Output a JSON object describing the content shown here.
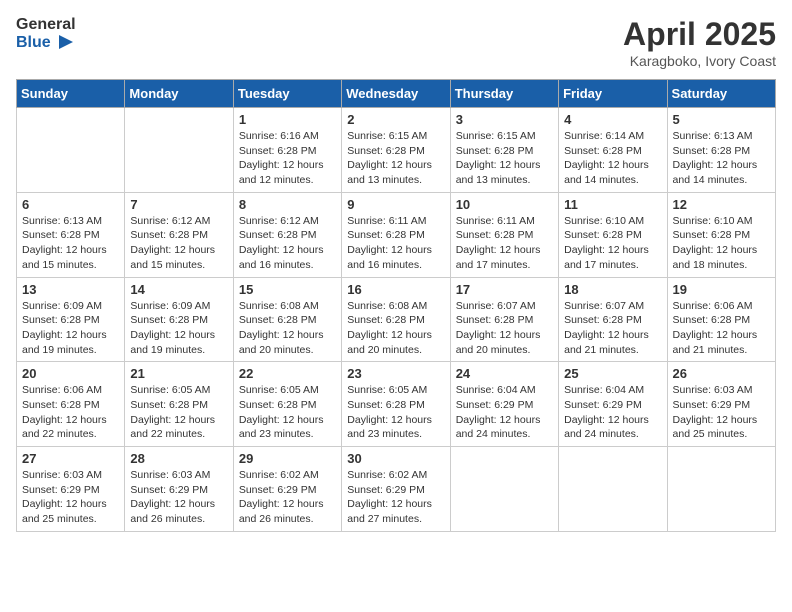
{
  "logo": {
    "text_general": "General",
    "text_blue": "Blue"
  },
  "title": "April 2025",
  "subtitle": "Karagboko, Ivory Coast",
  "weekdays": [
    "Sunday",
    "Monday",
    "Tuesday",
    "Wednesday",
    "Thursday",
    "Friday",
    "Saturday"
  ],
  "weeks": [
    [
      {
        "day": "",
        "info": ""
      },
      {
        "day": "",
        "info": ""
      },
      {
        "day": "1",
        "info": "Sunrise: 6:16 AM\nSunset: 6:28 PM\nDaylight: 12 hours and 12 minutes."
      },
      {
        "day": "2",
        "info": "Sunrise: 6:15 AM\nSunset: 6:28 PM\nDaylight: 12 hours and 13 minutes."
      },
      {
        "day": "3",
        "info": "Sunrise: 6:15 AM\nSunset: 6:28 PM\nDaylight: 12 hours and 13 minutes."
      },
      {
        "day": "4",
        "info": "Sunrise: 6:14 AM\nSunset: 6:28 PM\nDaylight: 12 hours and 14 minutes."
      },
      {
        "day": "5",
        "info": "Sunrise: 6:13 AM\nSunset: 6:28 PM\nDaylight: 12 hours and 14 minutes."
      }
    ],
    [
      {
        "day": "6",
        "info": "Sunrise: 6:13 AM\nSunset: 6:28 PM\nDaylight: 12 hours and 15 minutes."
      },
      {
        "day": "7",
        "info": "Sunrise: 6:12 AM\nSunset: 6:28 PM\nDaylight: 12 hours and 15 minutes."
      },
      {
        "day": "8",
        "info": "Sunrise: 6:12 AM\nSunset: 6:28 PM\nDaylight: 12 hours and 16 minutes."
      },
      {
        "day": "9",
        "info": "Sunrise: 6:11 AM\nSunset: 6:28 PM\nDaylight: 12 hours and 16 minutes."
      },
      {
        "day": "10",
        "info": "Sunrise: 6:11 AM\nSunset: 6:28 PM\nDaylight: 12 hours and 17 minutes."
      },
      {
        "day": "11",
        "info": "Sunrise: 6:10 AM\nSunset: 6:28 PM\nDaylight: 12 hours and 17 minutes."
      },
      {
        "day": "12",
        "info": "Sunrise: 6:10 AM\nSunset: 6:28 PM\nDaylight: 12 hours and 18 minutes."
      }
    ],
    [
      {
        "day": "13",
        "info": "Sunrise: 6:09 AM\nSunset: 6:28 PM\nDaylight: 12 hours and 19 minutes."
      },
      {
        "day": "14",
        "info": "Sunrise: 6:09 AM\nSunset: 6:28 PM\nDaylight: 12 hours and 19 minutes."
      },
      {
        "day": "15",
        "info": "Sunrise: 6:08 AM\nSunset: 6:28 PM\nDaylight: 12 hours and 20 minutes."
      },
      {
        "day": "16",
        "info": "Sunrise: 6:08 AM\nSunset: 6:28 PM\nDaylight: 12 hours and 20 minutes."
      },
      {
        "day": "17",
        "info": "Sunrise: 6:07 AM\nSunset: 6:28 PM\nDaylight: 12 hours and 20 minutes."
      },
      {
        "day": "18",
        "info": "Sunrise: 6:07 AM\nSunset: 6:28 PM\nDaylight: 12 hours and 21 minutes."
      },
      {
        "day": "19",
        "info": "Sunrise: 6:06 AM\nSunset: 6:28 PM\nDaylight: 12 hours and 21 minutes."
      }
    ],
    [
      {
        "day": "20",
        "info": "Sunrise: 6:06 AM\nSunset: 6:28 PM\nDaylight: 12 hours and 22 minutes."
      },
      {
        "day": "21",
        "info": "Sunrise: 6:05 AM\nSunset: 6:28 PM\nDaylight: 12 hours and 22 minutes."
      },
      {
        "day": "22",
        "info": "Sunrise: 6:05 AM\nSunset: 6:28 PM\nDaylight: 12 hours and 23 minutes."
      },
      {
        "day": "23",
        "info": "Sunrise: 6:05 AM\nSunset: 6:28 PM\nDaylight: 12 hours and 23 minutes."
      },
      {
        "day": "24",
        "info": "Sunrise: 6:04 AM\nSunset: 6:29 PM\nDaylight: 12 hours and 24 minutes."
      },
      {
        "day": "25",
        "info": "Sunrise: 6:04 AM\nSunset: 6:29 PM\nDaylight: 12 hours and 24 minutes."
      },
      {
        "day": "26",
        "info": "Sunrise: 6:03 AM\nSunset: 6:29 PM\nDaylight: 12 hours and 25 minutes."
      }
    ],
    [
      {
        "day": "27",
        "info": "Sunrise: 6:03 AM\nSunset: 6:29 PM\nDaylight: 12 hours and 25 minutes."
      },
      {
        "day": "28",
        "info": "Sunrise: 6:03 AM\nSunset: 6:29 PM\nDaylight: 12 hours and 26 minutes."
      },
      {
        "day": "29",
        "info": "Sunrise: 6:02 AM\nSunset: 6:29 PM\nDaylight: 12 hours and 26 minutes."
      },
      {
        "day": "30",
        "info": "Sunrise: 6:02 AM\nSunset: 6:29 PM\nDaylight: 12 hours and 27 minutes."
      },
      {
        "day": "",
        "info": ""
      },
      {
        "day": "",
        "info": ""
      },
      {
        "day": "",
        "info": ""
      }
    ]
  ]
}
